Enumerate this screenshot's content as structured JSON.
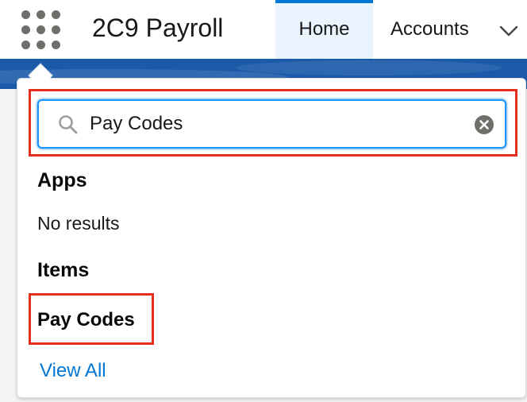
{
  "header": {
    "app_title": "2C9 Payroll",
    "tabs": [
      {
        "label": "Home",
        "active": true
      },
      {
        "label": "Accounts",
        "active": false
      }
    ],
    "icons": {
      "app_launcher": "waffle-grid-icon",
      "more": "chevron-down-icon"
    }
  },
  "search": {
    "value": "Pay Codes",
    "icons": {
      "search": "search-icon",
      "clear": "clear-icon"
    }
  },
  "results": {
    "apps_heading": "Apps",
    "apps_empty": "No results",
    "items_heading": "Items",
    "items": [
      {
        "label": "Pay Codes"
      }
    ],
    "view_all": "View All"
  },
  "colors": {
    "accent": "#0176d3",
    "highlight_border": "#e62e1f",
    "active_tab_bg": "#eaf4fe",
    "brand_band": "#1b5aa8"
  }
}
